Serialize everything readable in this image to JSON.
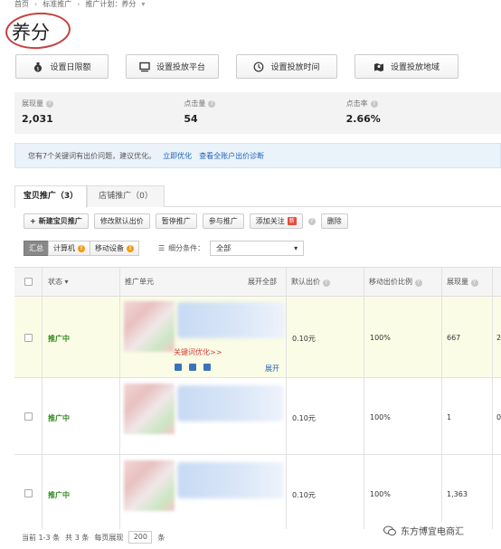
{
  "breadcrumb": {
    "home": "首页",
    "level2": "标准推广",
    "level3": "推广计划：养分"
  },
  "page_title": "养分",
  "settings_buttons": [
    {
      "label": "设置日限额",
      "icon": "money-bag-icon"
    },
    {
      "label": "设置投放平台",
      "icon": "monitor-icon"
    },
    {
      "label": "设置投放时间",
      "icon": "clock-icon"
    },
    {
      "label": "设置投放地域",
      "icon": "map-icon"
    }
  ],
  "stats": [
    {
      "label": "展现量",
      "value": "2,031"
    },
    {
      "label": "点击量",
      "value": "54"
    },
    {
      "label": "点击率",
      "value": "2.66%"
    }
  ],
  "notice": {
    "text": "您有7个关键词有出价问题，建议优化。",
    "link1": "立即优化",
    "link2": "查看全账户出价诊断"
  },
  "tabs": [
    {
      "label": "宝贝推广（3）"
    },
    {
      "label": "店铺推广（0）"
    }
  ],
  "toolbar": {
    "new_plus": "+",
    "new": "新建宝贝推广",
    "edit_bid": "修改默认出价",
    "pause": "暂停推广",
    "join": "参与推广",
    "add_follow": "添加关注",
    "new_badge": "新",
    "delete": "删除"
  },
  "filter": {
    "summary": "汇总",
    "computer": "计算机",
    "computer_badge": "!",
    "mobile": "移动设备",
    "mobile_badge": "!",
    "condition_label": "细分条件：",
    "condition_value": "全部"
  },
  "table": {
    "headers": {
      "status": "状态",
      "unit": "推广单元",
      "expand_all": "展开全部",
      "default_bid": "默认出价",
      "mobile_ratio": "移动出价比例",
      "impressions": "展现量"
    },
    "rows": [
      {
        "status": "推广中",
        "bid": "0.10元",
        "ratio": "100%",
        "impressions": "667",
        "next_col": "2",
        "optimize_link": "关键词优化>>",
        "expand": "展开"
      },
      {
        "status": "推广中",
        "bid": "0.10元",
        "ratio": "100%",
        "impressions": "1",
        "next_col": "0"
      },
      {
        "status": "推广中",
        "bid": "0.10元",
        "ratio": "100%",
        "impressions": "1,363",
        "next_col": ""
      }
    ]
  },
  "footer": {
    "range": "当前 1-3 条",
    "total": "共 3 条",
    "per_page_label": "每页展现",
    "per_page_value": "200",
    "unit": "条"
  },
  "watermark": {
    "text": "东方博宜电商汇"
  },
  "colors": {
    "status_green": "#2e8b1e",
    "link_blue": "#1e62b8",
    "highlight_row": "#fbfce6",
    "warn_orange": "#f39c12",
    "new_red": "#e74c3c"
  }
}
